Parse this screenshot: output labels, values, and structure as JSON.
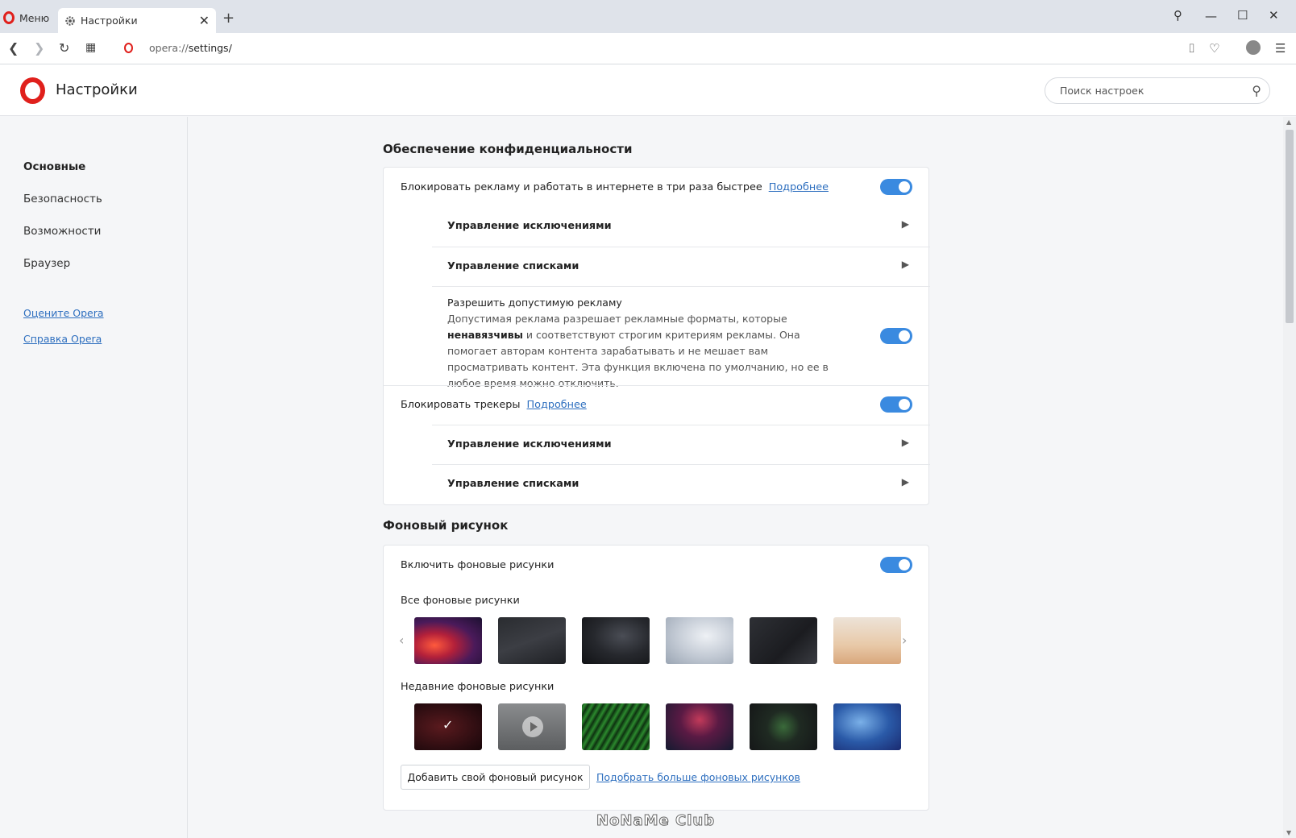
{
  "tabstrip": {
    "menu_label": "Меню",
    "tab_title": "Настройки",
    "new_tab": "+",
    "close_tab": "✕"
  },
  "window_controls": {
    "search": "⚲",
    "minimize": "—",
    "maximize": "☐",
    "close": "✕"
  },
  "addressbar": {
    "url_prefix": "opera://",
    "url_path": "settings/"
  },
  "header": {
    "title": "Настройки",
    "search_placeholder": "Поиск настроек"
  },
  "sidebar": {
    "items": [
      {
        "label": "Основные",
        "active": true
      },
      {
        "label": "Безопасность",
        "active": false
      },
      {
        "label": "Возможности",
        "active": false
      },
      {
        "label": "Браузер",
        "active": false
      }
    ],
    "links": [
      {
        "label": "Оцените Opera"
      },
      {
        "label": "Справка Opera"
      }
    ]
  },
  "privacy": {
    "title": "Обеспечение конфиденциальности",
    "block_ads": {
      "label": "Блокировать рекламу и работать в интернете в три раза быстрее",
      "link": "Подробнее",
      "enabled": true
    },
    "ads_exceptions": "Управление исключениями",
    "ads_lists": "Управление списками",
    "acceptable_ads": {
      "title": "Разрешить допустимую рекламу",
      "desc_before": "Допустимая реклама разрешает рекламные форматы, которые ",
      "desc_bold": "ненавязчивы",
      "desc_after": " и соответствуют строгим критериям рекламы. Она помогает авторам контента зарабатывать и не мешает вам просматривать контент. Эта функция включена по умолчанию, но ее в любое время можно отключить.",
      "enabled": true
    },
    "block_trackers": {
      "label": "Блокировать трекеры",
      "link": "Подробнее",
      "enabled": true
    },
    "trackers_exceptions": "Управление исключениями",
    "trackers_lists": "Управление списками"
  },
  "wallpaper": {
    "title": "Фоновый рисунок",
    "enable": {
      "label": "Включить фоновые рисунки",
      "enabled": true
    },
    "all_label": "Все фоновые рисунки",
    "recent_label": "Недавние фоновые рисунки",
    "add_button": "Добавить свой фоновый рисунок",
    "more_link": "Подобрать больше фоновых рисунков"
  },
  "watermark": "NoNaMe Club",
  "colors": {
    "toggle": "#3a8ae0",
    "link": "#2e6fbf",
    "opera_red": "#e0201c"
  }
}
